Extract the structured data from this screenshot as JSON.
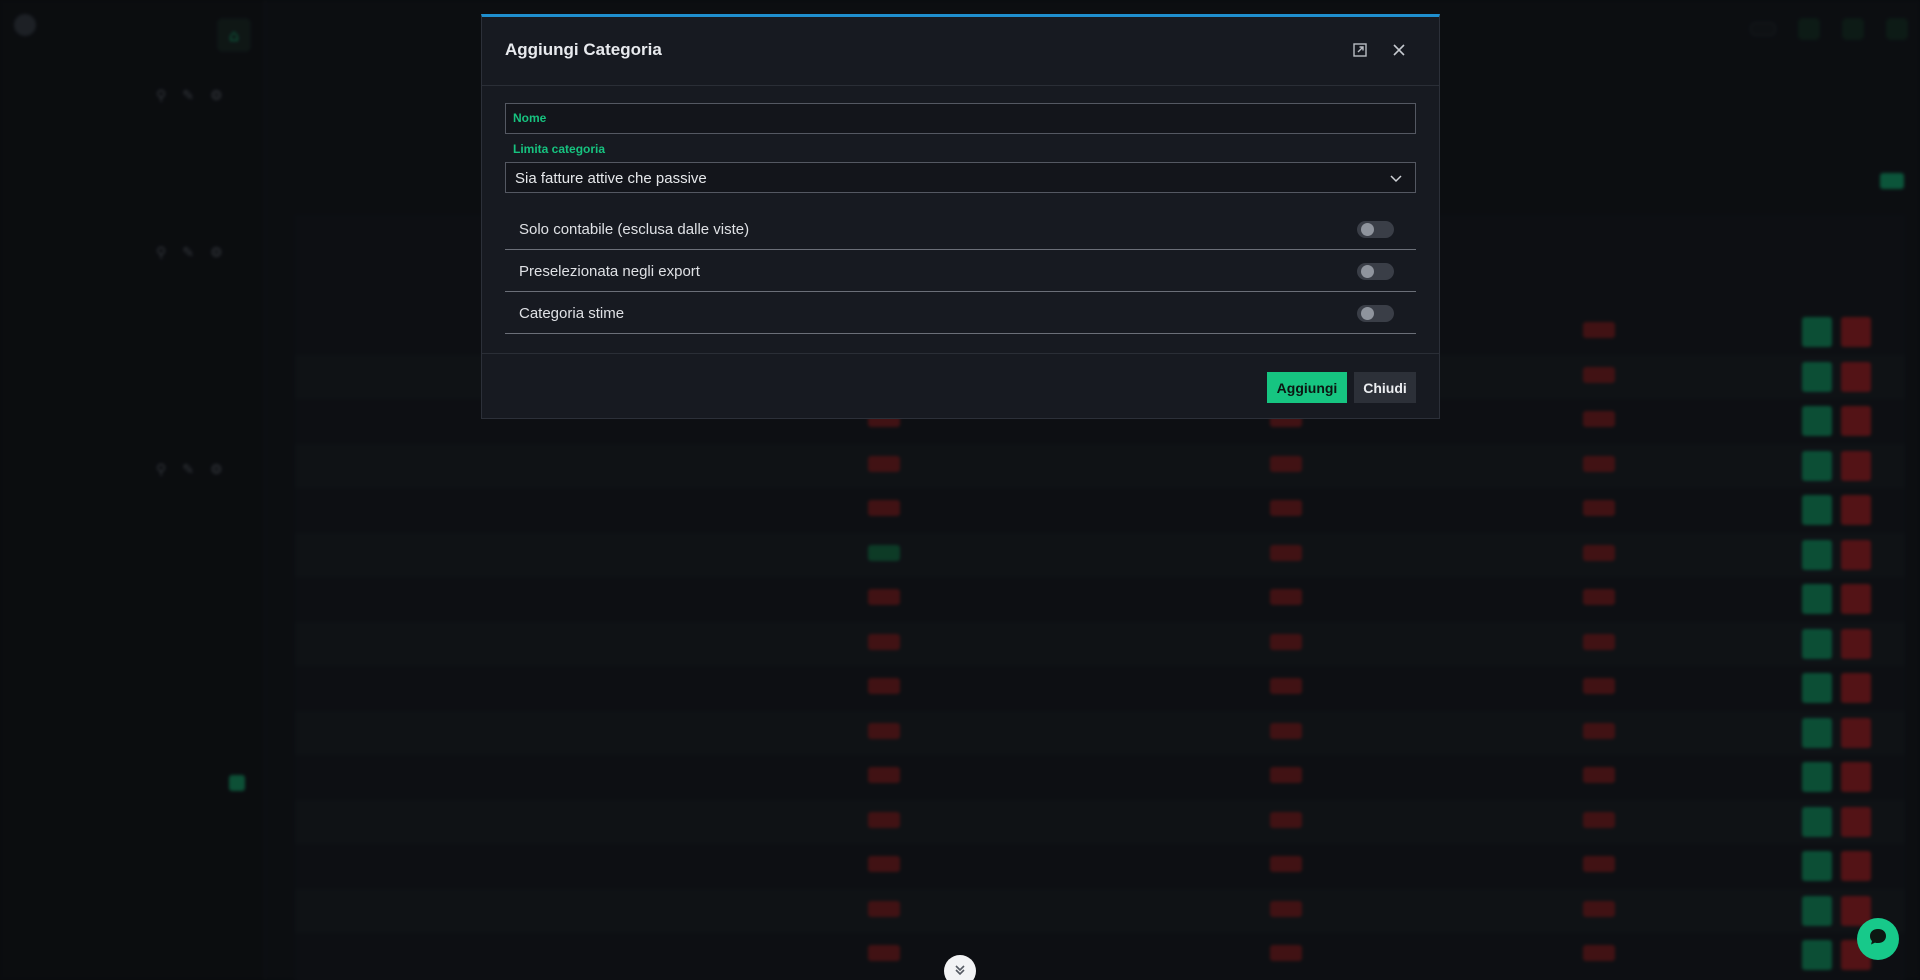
{
  "modal": {
    "title": "Aggiungi Categoria",
    "nome_label": "Nome",
    "nome_value": "",
    "limit_label": "Limita categoria",
    "limit_value": "Sia fatture attive che passive",
    "toggles": [
      {
        "label": "Solo contabile (esclusa dalle viste)",
        "on": false
      },
      {
        "label": "Preselezionata negli export",
        "on": false
      },
      {
        "label": "Categoria stime",
        "on": false
      }
    ],
    "add_label": "Aggiungi",
    "close_label": "Chiudi"
  },
  "colors": {
    "accent": "#16c581",
    "modal_top_border": "#1f8fcf",
    "danger": "#b12226"
  },
  "icons": [
    "expand-icon",
    "close-icon",
    "chevron-down-icon",
    "chevron-down-double-icon",
    "chat-icon"
  ]
}
